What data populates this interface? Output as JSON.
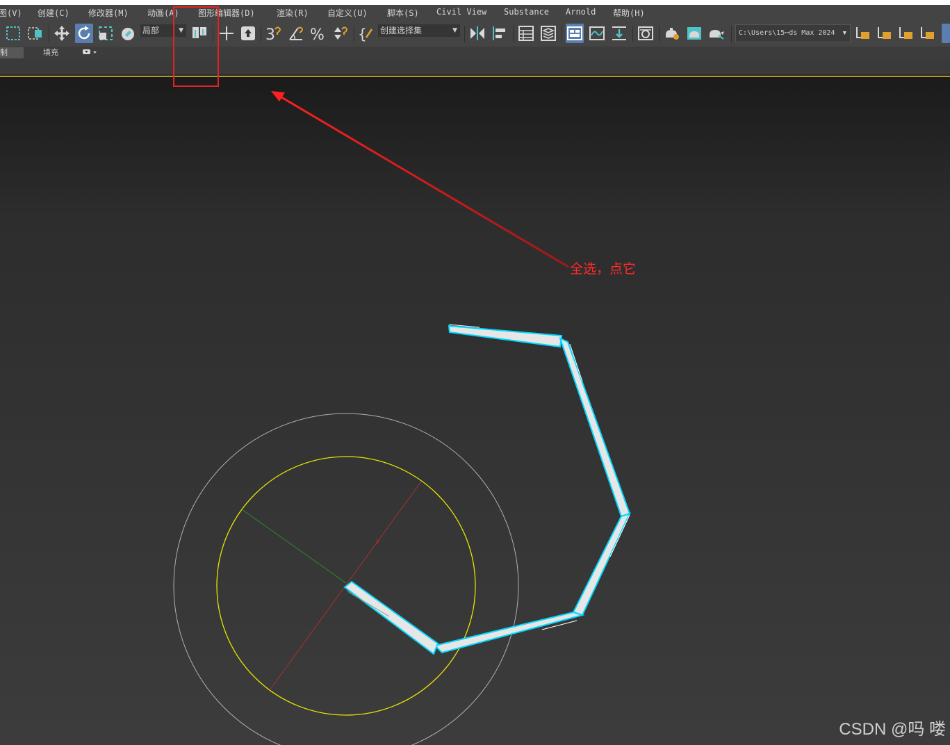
{
  "menu": [
    {
      "key": "view",
      "label": "图(V)"
    },
    {
      "key": "create",
      "label": "创建(C)"
    },
    {
      "key": "modifiers",
      "label": "修改器(M)"
    },
    {
      "key": "animation",
      "label": "动画(A)"
    },
    {
      "key": "graph_editors",
      "label": "图形编辑器(D)"
    },
    {
      "key": "rendering",
      "label": "渲染(R)"
    },
    {
      "key": "customize",
      "label": "自定义(U)"
    },
    {
      "key": "scripting",
      "label": "脚本(S)"
    },
    {
      "key": "civil_view",
      "label": "Civil View"
    },
    {
      "key": "substance",
      "label": "Substance"
    },
    {
      "key": "arnold",
      "label": "Arnold"
    },
    {
      "key": "help",
      "label": "帮助(H)"
    }
  ],
  "toolbar": {
    "coord_system": "局部",
    "selection_set_placeholder": "创建选择集",
    "project_path": "C:\\Users\\15⋯ds Max 2024"
  },
  "ribbon": {
    "tab_partial": "制",
    "tab_fill": "填充"
  },
  "annotation": {
    "text": "全选，点它"
  },
  "watermark": "CSDN @吗 喽",
  "colors": {
    "menubar_bg": "#444444",
    "toolbar_active": "#5a7fae",
    "icon_accent": "#4fc3c8",
    "highlight_red": "#e02424",
    "bone_selected_outline": "#00d8ff",
    "ik_circle_inner": "#e6e600",
    "ik_circle_outer": "#b0b0b0",
    "gizmo_x_axis": "#a83030",
    "gizmo_y_axis": "#2c8a2c",
    "gold_divider": "#b49a24"
  },
  "toolbar_icons": [
    "select-region-icon",
    "window-crossing-icon",
    "move-icon",
    "rotate-icon",
    "scale-icon",
    "selection-center-icon",
    "use-pivot-icon",
    "manipulate-icon",
    "keyboard-shortcut-icon",
    "snap-3d-icon",
    "angle-snap-icon",
    "percent-snap-icon",
    "spinner-snap-icon",
    "edit-named-selection-icon",
    "mirror-icon",
    "align-icon",
    "scene-explorer-icon",
    "layer-explorer-icon",
    "ribbon-toggle-icon",
    "curve-editor-icon",
    "dope-sheet-icon",
    "material-editor-icon",
    "render-setup-icon",
    "rendered-frame-icon",
    "render-icon",
    "render-online-icon"
  ]
}
